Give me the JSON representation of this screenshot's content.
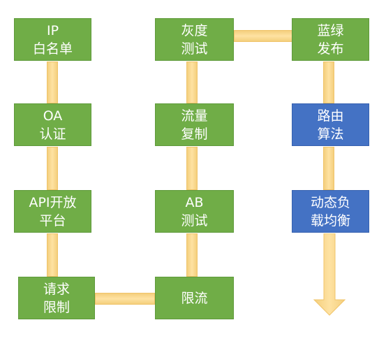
{
  "colors": {
    "green": "#70ad47",
    "blue": "#4472c4",
    "connector": "#f8d58b",
    "text": "#ffffff"
  },
  "boxes": {
    "ip_whitelist": {
      "line1": "IP",
      "line2": "白名单"
    },
    "oa_auth": {
      "line1": "OA",
      "line2": "认证"
    },
    "api_platform": {
      "line1": "API开放",
      "line2": "平台"
    },
    "request_limit": {
      "line1": "请求",
      "line2": "限制"
    },
    "gray_test": {
      "line1": "灰度",
      "line2": "测试"
    },
    "traffic_copy": {
      "line1": "流量",
      "line2": "复制"
    },
    "ab_test": {
      "line1": "AB",
      "line2": "测试"
    },
    "rate_limit": {
      "line1": "限流",
      "line2": ""
    },
    "blue_green": {
      "line1": "蓝绿",
      "line2": "发布"
    },
    "routing_algo": {
      "line1": "路由",
      "line2": "算法"
    },
    "dynamic_lb": {
      "line1": "动态负",
      "line2": "载均衡"
    }
  }
}
